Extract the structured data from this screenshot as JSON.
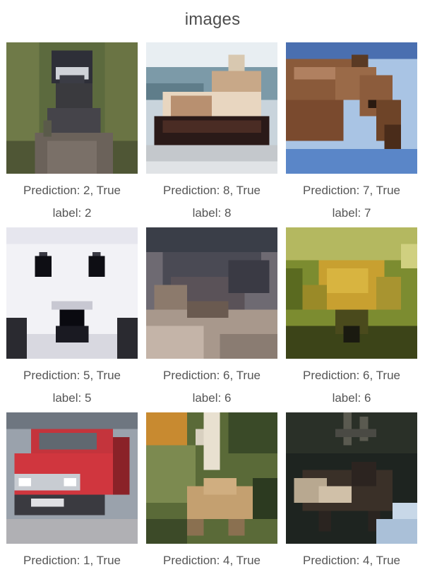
{
  "title": "images",
  "items": [
    {
      "prediction": "Prediction: 2, True",
      "label": "label: 2",
      "subject": "bird"
    },
    {
      "prediction": "Prediction: 8, True",
      "label": "label: 8",
      "subject": "ship"
    },
    {
      "prediction": "Prediction: 7, True",
      "label": "label: 7",
      "subject": "horse"
    },
    {
      "prediction": "Prediction: 5, True",
      "label": "label: 5",
      "subject": "dog"
    },
    {
      "prediction": "Prediction: 6, True",
      "label": "label: 6",
      "subject": "frog"
    },
    {
      "prediction": "Prediction: 6, True",
      "label": "label: 6",
      "subject": "frog"
    },
    {
      "prediction": "Prediction: 1, True",
      "label": "",
      "subject": "automobile"
    },
    {
      "prediction": "Prediction: 4, True",
      "label": "",
      "subject": "deer"
    },
    {
      "prediction": "Prediction: 4, True",
      "label": "",
      "subject": "deer"
    }
  ]
}
